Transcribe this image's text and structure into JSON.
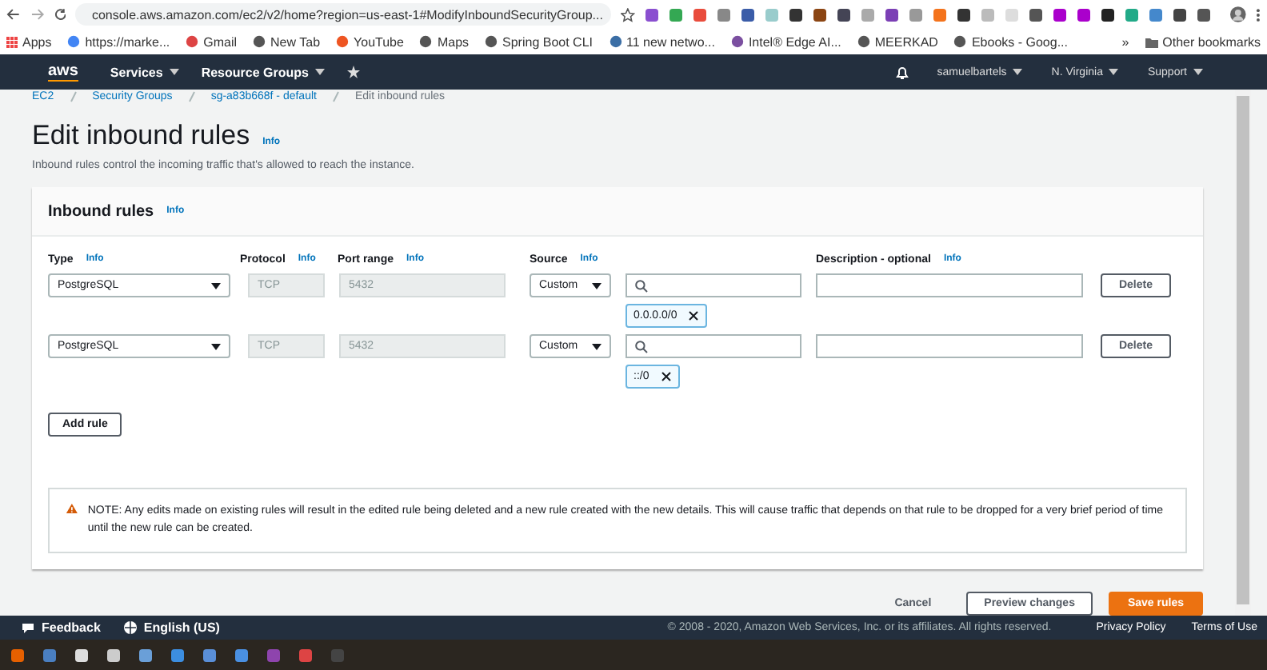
{
  "browser": {
    "url": "console.aws.amazon.com/ec2/v2/home?region=us-east-1#ModifyInboundSecurityGroup...",
    "apps": "Apps",
    "bookmarks": [
      "https://marke...",
      "Gmail",
      "New Tab",
      "YouTube",
      "Maps",
      "Spring Boot CLI",
      "11 new netwo...",
      "Intel® Edge AI...",
      "MEERKAD",
      "Ebooks - Goog..."
    ],
    "overflow": "»",
    "other": "Other bookmarks"
  },
  "nav": {
    "logo": "aws",
    "menus": [
      "Services",
      "Resource Groups"
    ],
    "user": "samuelbartels",
    "region": "N. Virginia",
    "support": "Support"
  },
  "breadcrumb": [
    "EC2",
    "Security Groups",
    "sg-a83b668f - default",
    "Edit inbound rules"
  ],
  "page": {
    "title": "Edit inbound rules",
    "info": "Info",
    "description": "Inbound rules control the incoming traffic that's allowed to reach the instance."
  },
  "panel": {
    "title": "Inbound rules",
    "info": "Info",
    "columns": [
      {
        "label": "Type",
        "info": "Info"
      },
      {
        "label": "Protocol",
        "info": "Info"
      },
      {
        "label": "Port range",
        "info": "Info"
      },
      {
        "label": "Source",
        "info": "Info"
      },
      {
        "label": "Description - optional",
        "info": "Info"
      }
    ],
    "rules": [
      {
        "type": "PostgreSQL",
        "protocol": "TCP",
        "port": "5432",
        "source": "Custom",
        "cidr": "0.0.0.0/0",
        "delete": "Delete"
      },
      {
        "type": "PostgreSQL",
        "protocol": "TCP",
        "port": "5432",
        "source": "Custom",
        "cidr": "::/0",
        "delete": "Delete"
      }
    ],
    "add_rule": "Add rule",
    "note": "NOTE: Any edits made on existing rules will result in the edited rule being deleted and a new rule created with the new details. This will cause traffic that depends on that rule to be dropped for a very brief period of time until the new rule can be created."
  },
  "actions": {
    "cancel": "Cancel",
    "preview": "Preview changes",
    "save": "Save rules"
  },
  "footer": {
    "feedback": "Feedback",
    "language": "English (US)",
    "copyright": "© 2008 - 2020, Amazon Web Services, Inc. or its affiliates. All rights reserved.",
    "privacy": "Privacy Policy",
    "terms": "Terms of Use"
  }
}
